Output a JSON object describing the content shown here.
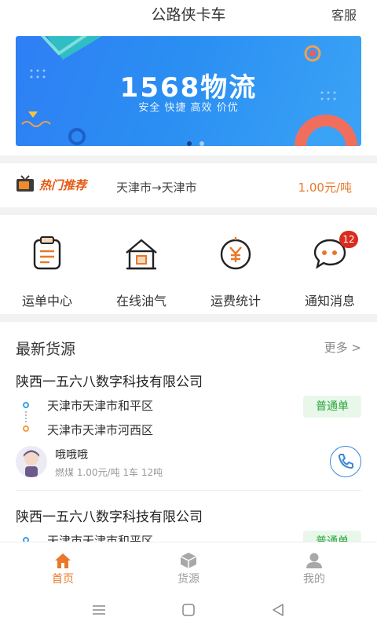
{
  "header": {
    "title": "公路侠卡车",
    "service_label": "客服"
  },
  "banner": {
    "title": "1568物流",
    "subtitle": "安全 快捷 高效 价优",
    "active_dot": 1,
    "dot_count": 2
  },
  "hot": {
    "tag": "热门推荐",
    "route": "天津市→天津市",
    "price": "1.00元/吨"
  },
  "features": [
    {
      "label": "运单中心",
      "icon": "clipboard-icon"
    },
    {
      "label": "在线油气",
      "icon": "gas-station-icon"
    },
    {
      "label": "运费统计",
      "icon": "yuan-coin-icon"
    },
    {
      "label": "通知消息",
      "icon": "chat-bubble-icon",
      "badge": "12"
    }
  ],
  "section": {
    "title": "最新货源",
    "more": "更多 >"
  },
  "cargo": [
    {
      "company": "陕西一五六八数字科技有限公司",
      "from": "天津市天津市和平区",
      "to": "天津市天津市河西区",
      "tag": "普通单",
      "user": "哦哦哦",
      "meta": "燃煤 1.00元/吨 1车 12吨"
    },
    {
      "company": "陕西一五六八数字科技有限公司",
      "from": "天津市天津市和平区",
      "tag": "普通单"
    }
  ],
  "tabs": [
    {
      "label": "首页",
      "icon": "home-icon",
      "active": true
    },
    {
      "label": "货源",
      "icon": "box-icon",
      "active": false
    },
    {
      "label": "我的",
      "icon": "user-icon",
      "active": false
    }
  ],
  "colors": {
    "accent": "#e8782a",
    "banner": "#2f7ff5",
    "badge": "#d92c1f",
    "tag_bg": "#e8f7ea",
    "tag_text": "#2aa63a"
  }
}
